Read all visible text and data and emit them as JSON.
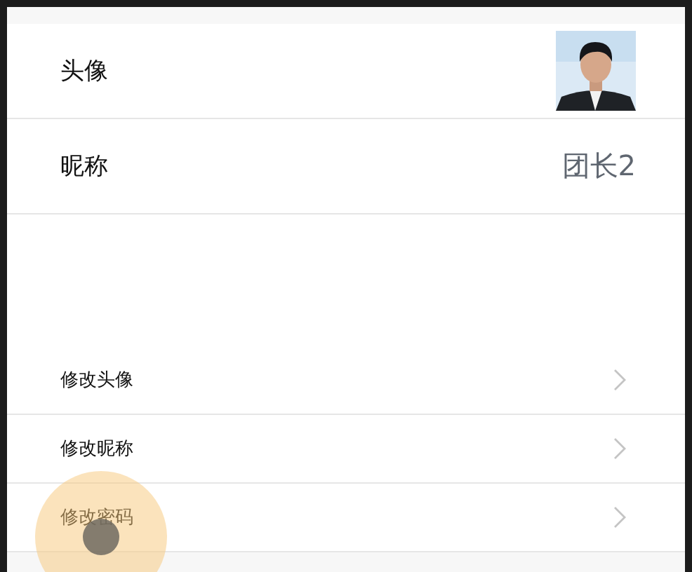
{
  "profile": [
    {
      "kind": "avatar",
      "label": "头像"
    },
    {
      "kind": "text",
      "label": "昵称",
      "value": "团长2"
    }
  ],
  "menu": [
    {
      "label": "修改头像"
    },
    {
      "label": "修改昵称"
    },
    {
      "label": "修改密码"
    }
  ]
}
